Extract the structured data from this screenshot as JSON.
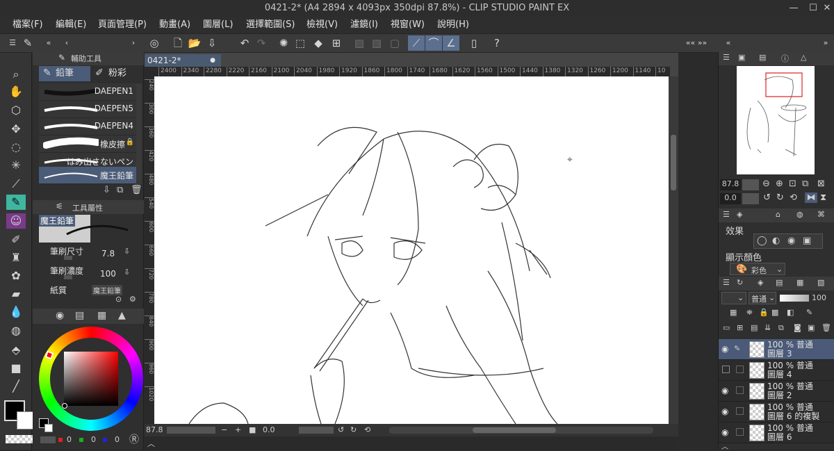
{
  "window": {
    "title": "0421-2* (A4 2894 x 4093px 350dpi 87.8%)  - CLIP STUDIO PAINT EX",
    "controls": [
      "—",
      "☐",
      "✕"
    ]
  },
  "menu": [
    "檔案(F)",
    "編輯(E)",
    "頁面管理(P)",
    "動畫(A)",
    "圖層(L)",
    "選擇範圍(S)",
    "檢視(V)",
    "濾鏡(I)",
    "視窗(W)",
    "說明(H)"
  ],
  "sub_tool": {
    "panel_title": "輔助工具",
    "tabs": [
      "鉛筆",
      "粉彩"
    ],
    "brushes": [
      "DAEPEN1",
      "DAEPEN5",
      "DAEPEN4",
      "橡皮擦",
      "はみ出さないペン",
      "魔王鉛筆"
    ],
    "selected_brush": "魔王鉛筆"
  },
  "tool_property": {
    "panel_title": "工具屬性",
    "preset_name": "魔王鉛筆",
    "brush_size_label": "筆刷尺寸",
    "brush_size_value": "7.8",
    "brush_density_label": "筆刷濃度",
    "brush_density_value": "100",
    "paper_label": "紙質",
    "paper_value": "魔王鉛筆"
  },
  "color": {
    "main_color": "#000000",
    "sub_color": "#ffffff",
    "rgb_values": [
      "0",
      "0",
      "0"
    ],
    "accent": "#3fb6a0"
  },
  "document": {
    "tab_label": "0421-2*",
    "ruler_top": [
      "2400",
      "2340",
      "2280",
      "2220",
      "2160",
      "2100",
      "2040",
      "1980",
      "1920",
      "1860",
      "1800",
      "1740",
      "1680",
      "1620",
      "1560",
      "1500",
      "1440",
      "1380",
      "1320",
      "1260",
      "1200",
      "1140",
      "10"
    ],
    "ruler_left": [
      "240",
      "300",
      "360",
      "420",
      "480",
      "540",
      "600",
      "660",
      "720",
      "780",
      "840",
      "900",
      "960",
      "1020"
    ],
    "zoom": "87.8",
    "rotation": "0.0"
  },
  "navigator": {
    "zoom": "87.8",
    "angle": "0.0"
  },
  "layer_property": {
    "effect_label": "效果",
    "display_color_label": "顯示顏色",
    "display_color_value": "彩色"
  },
  "layers": {
    "blend_mode": "普通",
    "opacity": "100",
    "items": [
      {
        "line1": "100 % 普通",
        "line2": "圖層 3",
        "selected": true,
        "visible": true
      },
      {
        "line1": "100 % 普通",
        "line2": "圖層 4",
        "selected": false,
        "visible": false
      },
      {
        "line1": "100 % 普通",
        "line2": "圖層 2",
        "selected": false,
        "visible": true
      },
      {
        "line1": "100 % 普通",
        "line2": "圖層 6 的複製",
        "selected": false,
        "visible": true
      },
      {
        "line1": "100 % 普通",
        "line2": "圖層 6",
        "selected": false,
        "visible": true
      }
    ]
  }
}
